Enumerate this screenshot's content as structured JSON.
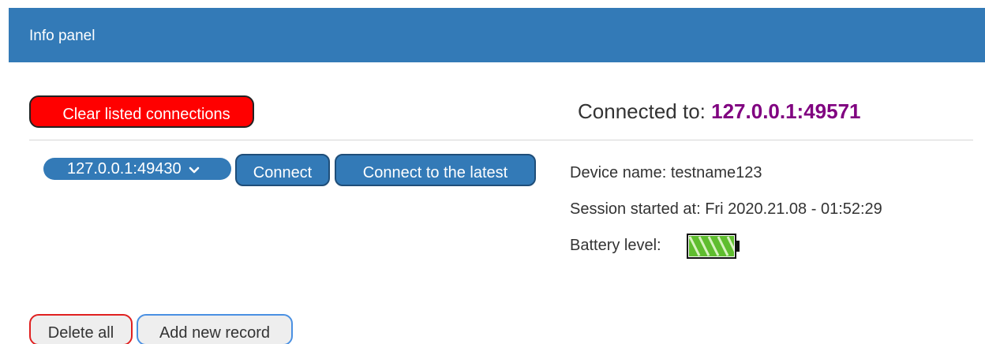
{
  "header": {
    "title": "Info panel",
    "color": "#337ab7"
  },
  "toolbar": {
    "clear_label": "Clear listed connections"
  },
  "connection": {
    "connected_prefix": "Connected to:",
    "connected_address": "127.0.0.1:49571",
    "selected_address": "127.0.0.1:49430",
    "connect_label": "Connect",
    "connect_latest_label": "Connect to the latest"
  },
  "device": {
    "name_line": "Device name: testname123",
    "session_line": "Session started at: Fri 2020.21.08 - 01:52:29",
    "battery_label": "Battery level:",
    "battery_level": 1.0,
    "battery_icon": "battery-full-icon"
  },
  "records": {
    "delete_all_label": "Delete all",
    "add_new_label": "Add new record"
  },
  "colors": {
    "accent": "#337ab7",
    "danger": "#ff0000",
    "address": "#800080",
    "battery": "#5fbd2f"
  }
}
